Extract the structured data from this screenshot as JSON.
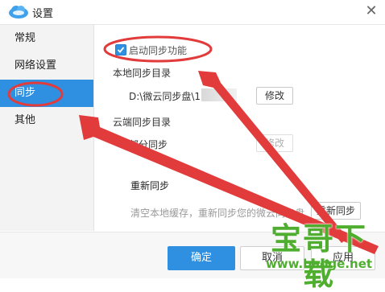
{
  "window": {
    "title": "设置",
    "close_glyph": "✕"
  },
  "sidebar": {
    "items": [
      {
        "label": "常规",
        "active": false
      },
      {
        "label": "网络设置",
        "active": false
      },
      {
        "label": "同步",
        "active": true
      },
      {
        "label": "其他",
        "active": false
      }
    ]
  },
  "sync": {
    "enable_label": "启动同步功能",
    "enable_checked": true,
    "local_dir_label": "本地同步目录",
    "local_dir_value": "D:\\微云同步盘\\1",
    "local_modify_label": "修改",
    "cloud_dir_label": "云端同步目录",
    "cloud_dir_value": "部分同步",
    "cloud_modify_label": "修改",
    "resync_title": "重新同步",
    "resync_desc": "清空本地缓存，重新同步您的微云同步盘",
    "resync_button": "重新同步"
  },
  "footer": {
    "ok_label": "确定",
    "cancel_label": "取消",
    "apply_label": "应用"
  },
  "watermark": {
    "big": "宝哥下载",
    "small": "www.baoge.net"
  },
  "colors": {
    "accent": "#2f8fe0",
    "annotation": "#e23b3b",
    "watermark": "#4fae2f"
  }
}
